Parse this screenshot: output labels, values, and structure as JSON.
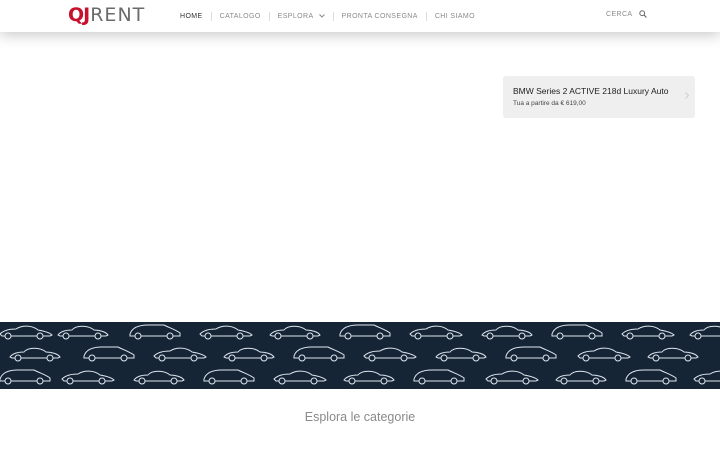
{
  "brand": {
    "mark": "QJ",
    "word": "RENT",
    "accent_color": "#c8102e"
  },
  "nav": {
    "items": [
      {
        "label": "HOME",
        "active": true
      },
      {
        "label": "CATALOGO"
      },
      {
        "label": "ESPLORA",
        "has_dropdown": true,
        "icon": "chevron-down-icon"
      },
      {
        "label": "PRONTA CONSEGNA"
      },
      {
        "label": "CHI SIAMO"
      }
    ]
  },
  "search": {
    "label": "CERCA",
    "icon": "search-icon"
  },
  "promo": {
    "title": "BMW Series 2 ACTIVE 218d Luxury Auto",
    "price": "Tua a partire da € 619,00",
    "icon": "chevron-right-icon"
  },
  "banner": {
    "background_color": "#152536",
    "icon": "car-silhouette-icon"
  },
  "categories": {
    "title": "Esplora le categorie"
  }
}
